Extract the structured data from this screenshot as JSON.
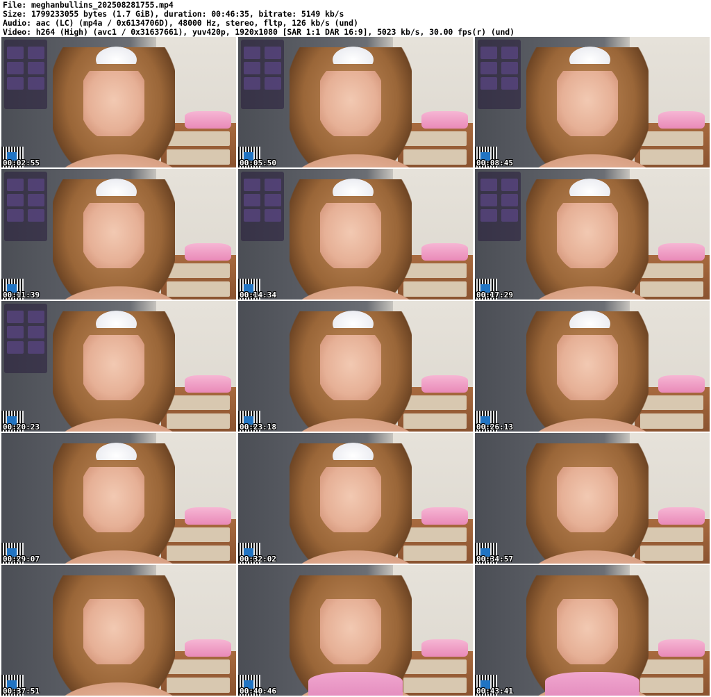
{
  "header": {
    "file_line": "File: meghanbullins_202508281755.mp4",
    "size_line": "Size: 1799233055 bytes (1.7 GiB), duration: 00:46:35, bitrate: 5149 kb/s",
    "audio_line": "Audio: aac (LC) (mp4a / 0x6134706D), 48000 Hz, stereo, fltp, 126 kb/s (und)",
    "video_line": "Video: h264 (High) (avc1 / 0x31637661), yuv420p, 1920x1080 [SAR 1:1 DAR 16:9], 5023 kb/s, 30.00 fps(r) (und)"
  },
  "thumbnails": [
    {
      "time": "00:02:55"
    },
    {
      "time": "00:05:50"
    },
    {
      "time": "00:08:45"
    },
    {
      "time": "00:11:39"
    },
    {
      "time": "00:14:34"
    },
    {
      "time": "00:17:29"
    },
    {
      "time": "00:20:23"
    },
    {
      "time": "00:23:18"
    },
    {
      "time": "00:26:13"
    },
    {
      "time": "00:29:07"
    },
    {
      "time": "00:32:02"
    },
    {
      "time": "00:34:57"
    },
    {
      "time": "00:37:51"
    },
    {
      "time": "00:40:46"
    },
    {
      "time": "00:43:41"
    }
  ]
}
